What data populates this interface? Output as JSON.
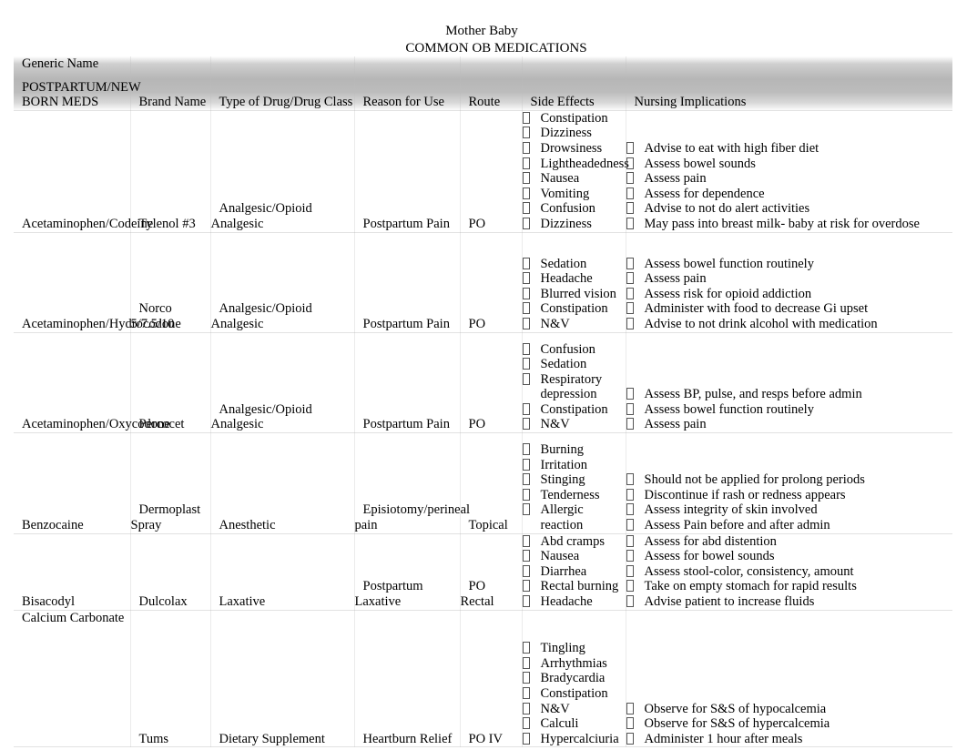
{
  "document": {
    "title_line_1": "Mother Baby",
    "title_line_2": "COMMON OB MEDICATIONS"
  },
  "table": {
    "headers": {
      "generic_name": "Generic Name",
      "brand_name": "Brand Name",
      "drug_class": "Type of Drug/Drug Class",
      "reason_for_use": "Reason for Use",
      "route": "Route",
      "side_effects": "Side Effects",
      "nursing_implications": "Nursing Implications"
    },
    "section_label": "POSTPARTUM/NEW BORN MEDS",
    "rows": [
      {
        "generic_name": "Acetaminophen/Codeine",
        "brand_name": "Tylenol #3",
        "drug_class": "Analgesic/Opioid Analgesic",
        "reason_for_use": "Postpartum Pain",
        "route": "PO",
        "side_effects": [
          "Constipation",
          "Dizziness",
          "Drowsiness",
          "Lightheadedness",
          "Nausea",
          "Vomiting",
          "Confusion",
          "Dizziness"
        ],
        "nursing_implications": [
          "Advise to eat with high fiber diet",
          "Assess bowel sounds",
          "Assess pain",
          "Assess for dependence",
          "Advise to not do alert activities",
          "May pass into breast milk- baby at risk for overdose"
        ]
      },
      {
        "generic_name": "Acetaminophen/Hydrocodone",
        "brand_name": "Norco 5/7.5/10",
        "drug_class": "Analgesic/Opioid Analgesic",
        "reason_for_use": "Postpartum Pain",
        "route": "PO",
        "side_effects": [
          "Sedation",
          "Headache",
          "Blurred vision",
          "Constipation",
          "N&V"
        ],
        "nursing_implications": [
          "Assess bowel function routinely",
          "Assess pain",
          "Assess risk for opioid addiction",
          "Administer with food to decrease Gi upset",
          "Advise to not drink alcohol with medication"
        ]
      },
      {
        "generic_name": "Acetaminophen/Oxycodone",
        "brand_name": "Percocet",
        "drug_class": "Analgesic/Opioid Analgesic",
        "reason_for_use": "Postpartum Pain",
        "route": "PO",
        "side_effects": [
          "Confusion",
          "Sedation",
          "Respiratory depression",
          "Constipation",
          "N&V"
        ],
        "nursing_implications": [
          "Assess BP, pulse, and resps before admin",
          "Assess bowel function routinely",
          "Assess pain"
        ]
      },
      {
        "generic_name": "Benzocaine",
        "brand_name": "Dermoplast Spray",
        "drug_class": "Anesthetic",
        "reason_for_use": "Episiotomy/perineal pain",
        "route": "Topical",
        "side_effects": [
          "Burning",
          "Irritation",
          "Stinging",
          "Tenderness",
          "Allergic reaction"
        ],
        "nursing_implications": [
          "Should not be applied for prolong periods",
          "Discontinue if rash or redness appears",
          "Assess integrity of skin involved",
          "Assess Pain before and after admin"
        ]
      },
      {
        "generic_name": "Bisacodyl",
        "brand_name": "Dulcolax",
        "drug_class": "Laxative",
        "reason_for_use": "Postpartum Laxative",
        "route": "PO Rectal",
        "side_effects": [
          "Abd cramps",
          "Nausea",
          "Diarrhea",
          "Rectal burning",
          "Headache"
        ],
        "nursing_implications": [
          "Assess for abd distention",
          "Assess for bowel sounds",
          "Assess stool-color, consistency, amount",
          "Take on empty stomach for rapid results",
          "Advise patient to increase fluids"
        ]
      },
      {
        "generic_name": "Calcium Carbonate",
        "brand_name": "Tums",
        "drug_class": "Dietary Supplement",
        "reason_for_use": "Heartburn Relief",
        "route": "PO IV",
        "side_effects": [
          "Tingling",
          "Arrhythmias",
          "Bradycardia",
          "Constipation",
          "N&V",
          "Calculi",
          "Hypercalciuria"
        ],
        "nursing_implications": [
          "Observe for S&S of hypocalcemia",
          "Observe for S&S of hypercalcemia",
          "Administer 1 hour after meals"
        ]
      }
    ]
  }
}
